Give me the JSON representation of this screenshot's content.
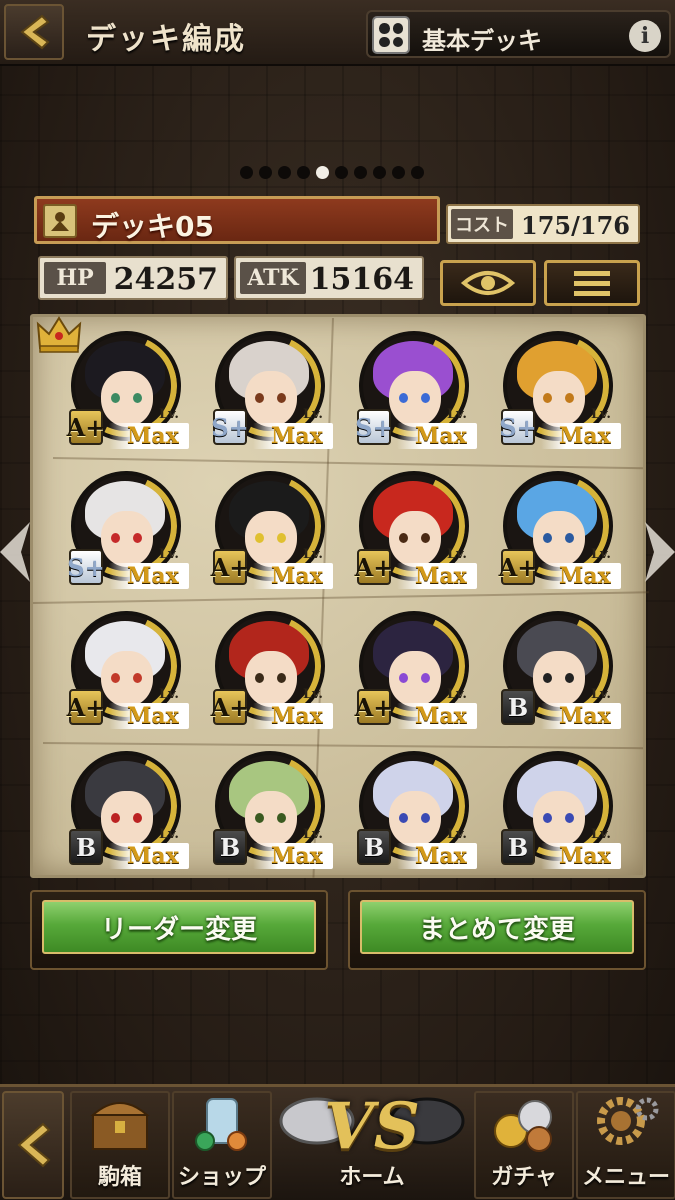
{
  "header": {
    "title": "デッキ編成",
    "deck_type": "基本デッキ",
    "info": "i"
  },
  "pagination": {
    "total": 10,
    "active": 5
  },
  "deck": {
    "name": "デッキ05",
    "cost_label": "コスト",
    "cost_value": "175/176",
    "hp_label": "HP",
    "hp_value": "24257",
    "atk_label": "ATK",
    "atk_value": "15164"
  },
  "units": [
    {
      "rank": "A+",
      "rank_class": "A",
      "lv": "Lv.",
      "level": "Max",
      "hair": "#1c1a20",
      "eye": "#3c8a62",
      "leader": true
    },
    {
      "rank": "S+",
      "rank_class": "S",
      "lv": "Lv.",
      "level": "Max",
      "hair": "#d9d2cc",
      "eye": "#7a3a1c"
    },
    {
      "rank": "S+",
      "rank_class": "S",
      "lv": "Lv.",
      "level": "Max",
      "hair": "#9a4fd0",
      "eye": "#3b6bd6"
    },
    {
      "rank": "S+",
      "rank_class": "S",
      "lv": "Lv.",
      "level": "Max",
      "hair": "#e0a030",
      "eye": "#c27a1a"
    },
    {
      "rank": "S+",
      "rank_class": "S",
      "lv": "Lv.",
      "level": "Max",
      "hair": "#e6e4e4",
      "eye": "#c52a2a"
    },
    {
      "rank": "A+",
      "rank_class": "A",
      "lv": "Lv.",
      "level": "Max",
      "hair": "#1b1b1b",
      "eye": "#e0c030"
    },
    {
      "rank": "A+",
      "rank_class": "A",
      "lv": "Lv.",
      "level": "Max",
      "hair": "#c8281e",
      "eye": "#4a2a14"
    },
    {
      "rank": "A+",
      "rank_class": "A",
      "lv": "Lv.",
      "level": "Max",
      "hair": "#5aa6e4",
      "eye": "#2a5aa0"
    },
    {
      "rank": "A+",
      "rank_class": "A",
      "lv": "Lv.",
      "level": "Max",
      "hair": "#e8e8ec",
      "eye": "#c23a2a"
    },
    {
      "rank": "A+",
      "rank_class": "A",
      "lv": "Lv.",
      "level": "Max",
      "hair": "#b2261c",
      "eye": "#3a2a18"
    },
    {
      "rank": "A+",
      "rank_class": "A",
      "lv": "Lv.",
      "level": "Max",
      "hair": "#2c2440",
      "eye": "#8a4ad4"
    },
    {
      "rank": "B",
      "rank_class": "B",
      "lv": "Lv.",
      "level": "Max",
      "hair": "#4a4a52",
      "eye": "#222"
    },
    {
      "rank": "B",
      "rank_class": "B",
      "lv": "Lv.",
      "level": "Max",
      "hair": "#3a3a40",
      "eye": "#b22"
    },
    {
      "rank": "B",
      "rank_class": "B",
      "lv": "Lv.",
      "level": "Max",
      "hair": "#a8c680",
      "eye": "#3a5a20"
    },
    {
      "rank": "B",
      "rank_class": "B",
      "lv": "Lv.",
      "level": "Max",
      "hair": "#cfd3ea",
      "eye": "#3a4ab4"
    },
    {
      "rank": "B",
      "rank_class": "B",
      "lv": "Lv.",
      "level": "Max",
      "hair": "#cfd3ea",
      "eye": "#3a4ab4"
    }
  ],
  "buttons": {
    "leader_change": "リーダー変更",
    "bulk_change": "まとめて変更"
  },
  "nav": {
    "box": "駒箱",
    "shop": "ショップ",
    "home": "ホーム",
    "home_badge": "VS",
    "gacha": "ガチャ",
    "menu": "メニュー"
  },
  "colors": {
    "accent_gold": "#c9a24e",
    "banner_red": "#8e3a1e",
    "button_green": "#57a93a"
  }
}
